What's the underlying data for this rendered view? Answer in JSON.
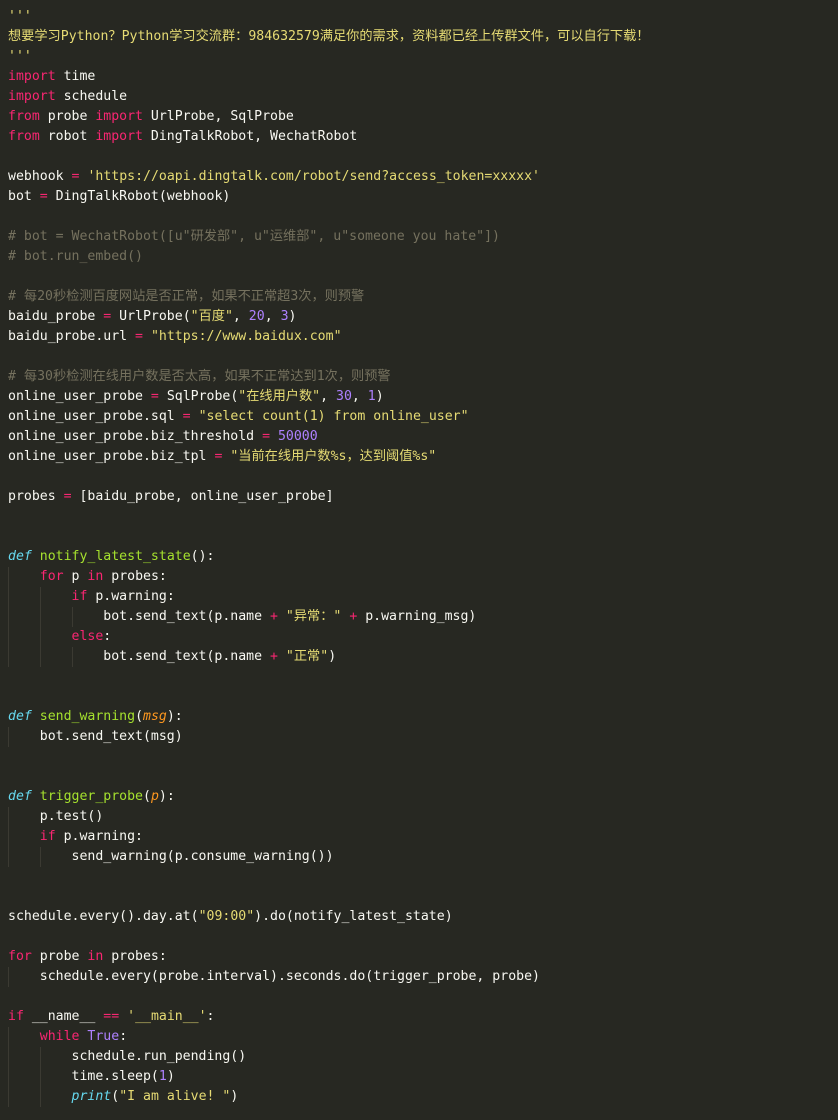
{
  "editor": {
    "language": "python",
    "lines": [
      [
        {
          "t": "'''",
          "c": "str"
        }
      ],
      [
        {
          "t": "想要学习Python？Python学习交流群：984632579满足你的需求，资料都已经上传群文件，可以自行下载！",
          "c": "str"
        }
      ],
      [
        {
          "t": "'''",
          "c": "str"
        }
      ],
      [
        {
          "t": "import",
          "c": "kw"
        },
        {
          "t": " time",
          "c": "txt"
        }
      ],
      [
        {
          "t": "import",
          "c": "kw"
        },
        {
          "t": " schedule",
          "c": "txt"
        }
      ],
      [
        {
          "t": "from",
          "c": "kw"
        },
        {
          "t": " probe ",
          "c": "txt"
        },
        {
          "t": "import",
          "c": "kw"
        },
        {
          "t": " UrlProbe, SqlProbe",
          "c": "txt"
        }
      ],
      [
        {
          "t": "from",
          "c": "kw"
        },
        {
          "t": " robot ",
          "c": "txt"
        },
        {
          "t": "import",
          "c": "kw"
        },
        {
          "t": " DingTalkRobot, WechatRobot",
          "c": "txt"
        }
      ],
      [],
      [
        {
          "t": "webhook ",
          "c": "txt"
        },
        {
          "t": "=",
          "c": "kw"
        },
        {
          "t": " ",
          "c": "txt"
        },
        {
          "t": "'https://oapi.dingtalk.com/robot/send?access_token=xxxxx'",
          "c": "str"
        }
      ],
      [
        {
          "t": "bot ",
          "c": "txt"
        },
        {
          "t": "=",
          "c": "kw"
        },
        {
          "t": " DingTalkRobot(webhook)",
          "c": "txt"
        }
      ],
      [],
      [
        {
          "t": "# bot = WechatRobot([u\"研发部\", u\"运维部\", u\"someone you hate\"])",
          "c": "cmt"
        }
      ],
      [
        {
          "t": "# bot.run_embed()",
          "c": "cmt"
        }
      ],
      [],
      [
        {
          "t": "# 每20秒检测百度网站是否正常，如果不正常超3次，则预警",
          "c": "cmt"
        }
      ],
      [
        {
          "t": "baidu_probe ",
          "c": "txt"
        },
        {
          "t": "=",
          "c": "kw"
        },
        {
          "t": " UrlProbe(",
          "c": "txt"
        },
        {
          "t": "\"百度\"",
          "c": "str"
        },
        {
          "t": ", ",
          "c": "txt"
        },
        {
          "t": "20",
          "c": "num"
        },
        {
          "t": ", ",
          "c": "txt"
        },
        {
          "t": "3",
          "c": "num"
        },
        {
          "t": ")",
          "c": "txt"
        }
      ],
      [
        {
          "t": "baidu_probe.url ",
          "c": "txt"
        },
        {
          "t": "=",
          "c": "kw"
        },
        {
          "t": " ",
          "c": "txt"
        },
        {
          "t": "\"https://www.baidux.com\"",
          "c": "str"
        }
      ],
      [],
      [
        {
          "t": "# 每30秒检测在线用户数是否太高，如果不正常达到1次，则预警",
          "c": "cmt"
        }
      ],
      [
        {
          "t": "online_user_probe ",
          "c": "txt"
        },
        {
          "t": "=",
          "c": "kw"
        },
        {
          "t": " SqlProbe(",
          "c": "txt"
        },
        {
          "t": "\"在线用户数\"",
          "c": "str"
        },
        {
          "t": ", ",
          "c": "txt"
        },
        {
          "t": "30",
          "c": "num"
        },
        {
          "t": ", ",
          "c": "txt"
        },
        {
          "t": "1",
          "c": "num"
        },
        {
          "t": ")",
          "c": "txt"
        }
      ],
      [
        {
          "t": "online_user_probe.sql ",
          "c": "txt"
        },
        {
          "t": "=",
          "c": "kw"
        },
        {
          "t": " ",
          "c": "txt"
        },
        {
          "t": "\"select count(1) from online_user\"",
          "c": "str"
        }
      ],
      [
        {
          "t": "online_user_probe.biz_threshold ",
          "c": "txt"
        },
        {
          "t": "=",
          "c": "kw"
        },
        {
          "t": " ",
          "c": "txt"
        },
        {
          "t": "50000",
          "c": "num"
        }
      ],
      [
        {
          "t": "online_user_probe.biz_tpl ",
          "c": "txt"
        },
        {
          "t": "=",
          "c": "kw"
        },
        {
          "t": " ",
          "c": "txt"
        },
        {
          "t": "\"当前在线用户数%s，达到阈值%s\"",
          "c": "str"
        }
      ],
      [],
      [
        {
          "t": "probes ",
          "c": "txt"
        },
        {
          "t": "=",
          "c": "kw"
        },
        {
          "t": " [baidu_probe, online_user_probe]",
          "c": "txt"
        }
      ],
      [],
      [],
      [
        {
          "t": "def",
          "c": "dkw"
        },
        {
          "t": " ",
          "c": "txt"
        },
        {
          "t": "notify_latest_state",
          "c": "fn"
        },
        {
          "t": "():",
          "c": "txt"
        }
      ],
      [
        {
          "t": "    ",
          "c": "txt"
        },
        {
          "t": "for",
          "c": "kw"
        },
        {
          "t": " p ",
          "c": "txt"
        },
        {
          "t": "in",
          "c": "kw"
        },
        {
          "t": " probes:",
          "c": "txt"
        }
      ],
      [
        {
          "t": "        ",
          "c": "txt"
        },
        {
          "t": "if",
          "c": "kw"
        },
        {
          "t": " p.warning:",
          "c": "txt"
        }
      ],
      [
        {
          "t": "            bot.send_text(p.name ",
          "c": "txt"
        },
        {
          "t": "+",
          "c": "kw"
        },
        {
          "t": " ",
          "c": "txt"
        },
        {
          "t": "\"异常：\"",
          "c": "str"
        },
        {
          "t": " ",
          "c": "txt"
        },
        {
          "t": "+",
          "c": "kw"
        },
        {
          "t": " p.warning_msg)",
          "c": "txt"
        }
      ],
      [
        {
          "t": "        ",
          "c": "txt"
        },
        {
          "t": "else",
          "c": "kw"
        },
        {
          "t": ":",
          "c": "txt"
        }
      ],
      [
        {
          "t": "            bot.send_text(p.name ",
          "c": "txt"
        },
        {
          "t": "+",
          "c": "kw"
        },
        {
          "t": " ",
          "c": "txt"
        },
        {
          "t": "\"正常\"",
          "c": "str"
        },
        {
          "t": ")",
          "c": "txt"
        }
      ],
      [],
      [],
      [
        {
          "t": "def",
          "c": "dkw"
        },
        {
          "t": " ",
          "c": "txt"
        },
        {
          "t": "send_warning",
          "c": "fn"
        },
        {
          "t": "(",
          "c": "txt"
        },
        {
          "t": "msg",
          "c": "param"
        },
        {
          "t": "):",
          "c": "txt"
        }
      ],
      [
        {
          "t": "    bot.send_text(msg)",
          "c": "txt"
        }
      ],
      [],
      [],
      [
        {
          "t": "def",
          "c": "dkw"
        },
        {
          "t": " ",
          "c": "txt"
        },
        {
          "t": "trigger_probe",
          "c": "fn"
        },
        {
          "t": "(",
          "c": "txt"
        },
        {
          "t": "p",
          "c": "param"
        },
        {
          "t": "):",
          "c": "txt"
        }
      ],
      [
        {
          "t": "    p.test()",
          "c": "txt"
        }
      ],
      [
        {
          "t": "    ",
          "c": "txt"
        },
        {
          "t": "if",
          "c": "kw"
        },
        {
          "t": " p.warning:",
          "c": "txt"
        }
      ],
      [
        {
          "t": "        send_warning(p.consume_warning())",
          "c": "txt"
        }
      ],
      [],
      [],
      [
        {
          "t": "schedule.every().day.at(",
          "c": "txt"
        },
        {
          "t": "\"09:00\"",
          "c": "str"
        },
        {
          "t": ").do(notify_latest_state)",
          "c": "txt"
        }
      ],
      [],
      [
        {
          "t": "for",
          "c": "kw"
        },
        {
          "t": " probe ",
          "c": "txt"
        },
        {
          "t": "in",
          "c": "kw"
        },
        {
          "t": " probes:",
          "c": "txt"
        }
      ],
      [
        {
          "t": "    schedule.every(probe.interval).seconds.do(trigger_probe, probe)",
          "c": "txt"
        }
      ],
      [],
      [
        {
          "t": "if",
          "c": "kw"
        },
        {
          "t": " __name__ ",
          "c": "txt"
        },
        {
          "t": "==",
          "c": "kw"
        },
        {
          "t": " ",
          "c": "txt"
        },
        {
          "t": "'__main__'",
          "c": "str"
        },
        {
          "t": ":",
          "c": "txt"
        }
      ],
      [
        {
          "t": "    ",
          "c": "txt"
        },
        {
          "t": "while",
          "c": "kw"
        },
        {
          "t": " ",
          "c": "txt"
        },
        {
          "t": "True",
          "c": "num"
        },
        {
          "t": ":",
          "c": "txt"
        }
      ],
      [
        {
          "t": "        schedule.run_pending()",
          "c": "txt"
        }
      ],
      [
        {
          "t": "        time.sleep(",
          "c": "txt"
        },
        {
          "t": "1",
          "c": "num"
        },
        {
          "t": ")",
          "c": "txt"
        }
      ],
      [
        {
          "t": "        ",
          "c": "txt"
        },
        {
          "t": "print",
          "c": "dkw"
        },
        {
          "t": "(",
          "c": "txt"
        },
        {
          "t": "\"I am alive! \"",
          "c": "str"
        },
        {
          "t": ")",
          "c": "txt"
        }
      ]
    ]
  },
  "colors": {
    "background": "#272822",
    "keyword": "#f92672",
    "storage": "#66d9ef",
    "string": "#e6db74",
    "number": "#ae81ff",
    "comment": "#75715e",
    "function": "#a6e22e",
    "parameter": "#fd971f",
    "text": "#f8f8f2"
  }
}
